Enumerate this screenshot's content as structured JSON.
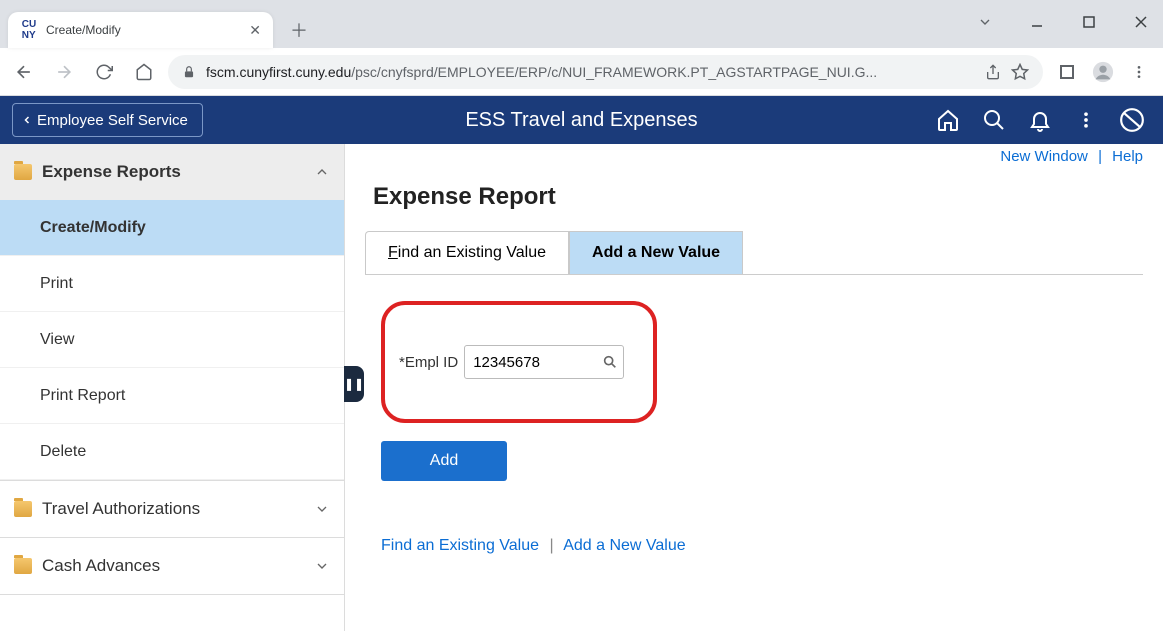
{
  "browser": {
    "tab_title": "Create/Modify",
    "url_host": "fscm.cunyfirst.cuny.edu",
    "url_path": "/psc/cnyfsprd/EMPLOYEE/ERP/c/NUI_FRAMEWORK.PT_AGSTARTPAGE_NUI.G..."
  },
  "header": {
    "back_label": "Employee Self Service",
    "title": "ESS Travel and Expenses"
  },
  "sidebar": {
    "sections": [
      {
        "label": "Expense Reports",
        "expanded": true,
        "items": [
          {
            "label": "Create/Modify",
            "active": true
          },
          {
            "label": "Print"
          },
          {
            "label": "View"
          },
          {
            "label": "Print Report"
          },
          {
            "label": "Delete"
          }
        ]
      },
      {
        "label": "Travel Authorizations",
        "expanded": false
      },
      {
        "label": "Cash Advances",
        "expanded": false
      }
    ]
  },
  "top_links": {
    "new_window": "New Window",
    "help": "Help"
  },
  "page": {
    "title": "Expense Report",
    "tabs": {
      "find": "Find an Existing Value",
      "find_u": "F",
      "find_rest": "ind an Existing Value",
      "add": "Add a New Value"
    },
    "field_label": "*Empl ID",
    "empl_id_value": "12345678",
    "add_button": "Add",
    "bottom": {
      "find": "Find an Existing Value",
      "add": "Add a New Value"
    }
  }
}
